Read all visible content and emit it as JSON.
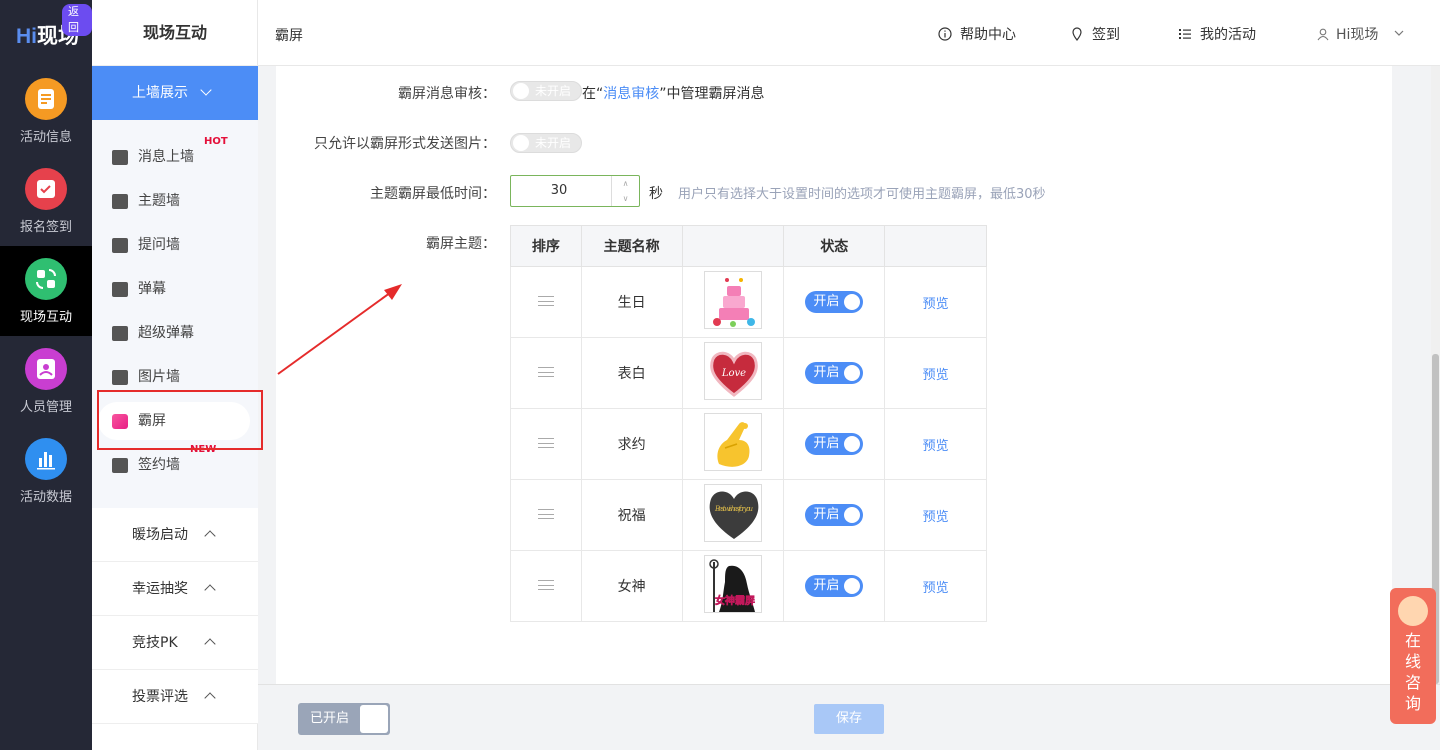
{
  "brand": {
    "logo_hi": "Hi",
    "logo_text": "现场",
    "back_badge": "返回"
  },
  "nav": [
    {
      "label": "活动信息",
      "icon": "document-icon",
      "color": "#f59a23"
    },
    {
      "label": "报名签到",
      "icon": "calendar-check-icon",
      "color": "#e6414c"
    },
    {
      "label": "现场互动",
      "icon": "interaction-icon",
      "color": "#2fbf71"
    },
    {
      "label": "人员管理",
      "icon": "user-card-icon",
      "color": "#c93ed1"
    },
    {
      "label": "活动数据",
      "icon": "bar-chart-icon",
      "color": "#2f8ff0"
    }
  ],
  "side": {
    "title": "现场互动",
    "group_label": "上墙展示",
    "items": [
      {
        "label": "消息上墙",
        "tag": "HOT"
      },
      {
        "label": "主题墙",
        "tag": ""
      },
      {
        "label": "提问墙",
        "tag": ""
      },
      {
        "label": "弹幕",
        "tag": ""
      },
      {
        "label": "超级弹幕",
        "tag": ""
      },
      {
        "label": "图片墙",
        "tag": ""
      },
      {
        "label": "霸屏",
        "tag": ""
      },
      {
        "label": "签约墙",
        "tag": "NEW"
      }
    ],
    "collapsed": [
      "暖场启动",
      "幸运抽奖",
      "竞技PK",
      "投票评选"
    ]
  },
  "topbar": {
    "breadcrumb": "霸屏",
    "help": "帮助中心",
    "signin": "签到",
    "my_activities": "我的活动",
    "user": "Hi现场"
  },
  "form": {
    "review_label": "霸屏消息审核：",
    "review_switch": "未开启",
    "review_note_prefix": "在“",
    "review_note_link": "消息审核",
    "review_note_suffix": "”中管理霸屏消息",
    "image_only_label": "只允许以霸屏形式发送图片：",
    "image_only_switch": "未开启",
    "min_time_label": "主题霸屏最低时间：",
    "min_time_value": "30",
    "min_time_unit": "秒",
    "min_time_hint": "用户只有选择大于设置时间的选项才可使用主题霸屏，最低30秒",
    "theme_label": "霸屏主题："
  },
  "table": {
    "headers": [
      "排序",
      "主题名称",
      "",
      "状态",
      ""
    ],
    "rows": [
      {
        "name": "生日",
        "status": "开启",
        "action": "预览",
        "thumb": "cake"
      },
      {
        "name": "表白",
        "status": "开启",
        "action": "预览",
        "thumb": "heart-love"
      },
      {
        "name": "求约",
        "status": "开启",
        "action": "预览",
        "thumb": "finger-heart"
      },
      {
        "name": "祝福",
        "status": "开启",
        "action": "预览",
        "thumb": "best-wishes-heart"
      },
      {
        "name": "女神",
        "status": "开启",
        "action": "预览",
        "thumb": "goddess"
      }
    ]
  },
  "thumb_text": {
    "love": "Love",
    "best_wishes": "Best wishes for you",
    "goddess": "女神霸屏"
  },
  "bottom": {
    "enabled_label": "已开启",
    "save_label": "保存"
  },
  "consult": {
    "text": "在线咨询"
  }
}
